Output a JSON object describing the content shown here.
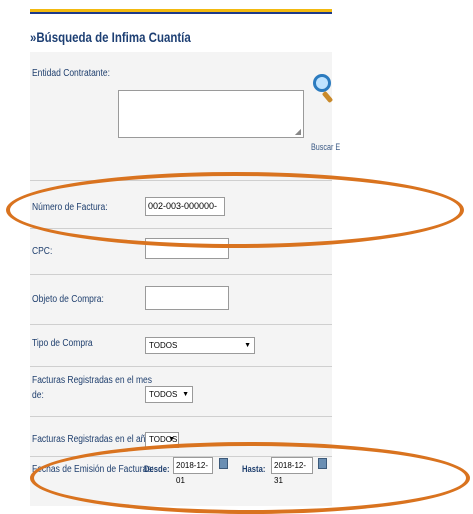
{
  "title": "»Búsqueda de Infima Cuantía",
  "entidad": {
    "label": "Entidad Contratante:",
    "value": ""
  },
  "search": {
    "label": "Buscar E",
    "icon": "magnifier-icon"
  },
  "numero_factura": {
    "label": "Número de Factura:",
    "value": "002-003-000000-"
  },
  "cpc": {
    "label": "CPC:",
    "value": ""
  },
  "objeto": {
    "label": "Objeto de Compra:",
    "value": ""
  },
  "tipo": {
    "label": "Tipo de Compra",
    "selected": "TODOS"
  },
  "mes": {
    "label_line1": "Facturas Registradas en el mes",
    "label_line2": "de:",
    "selected": "TODOS"
  },
  "anio": {
    "label": "Facturas Registradas en el año:",
    "selected": "TODOS"
  },
  "emision": {
    "label": "Fechas de Emisión de Facturas:",
    "desde_label": "Desde:",
    "desde_value": "2018-12-01",
    "hasta_label": "Hasta:",
    "hasta_value": "2018-12-31"
  },
  "annotation_color": "#d9731f"
}
